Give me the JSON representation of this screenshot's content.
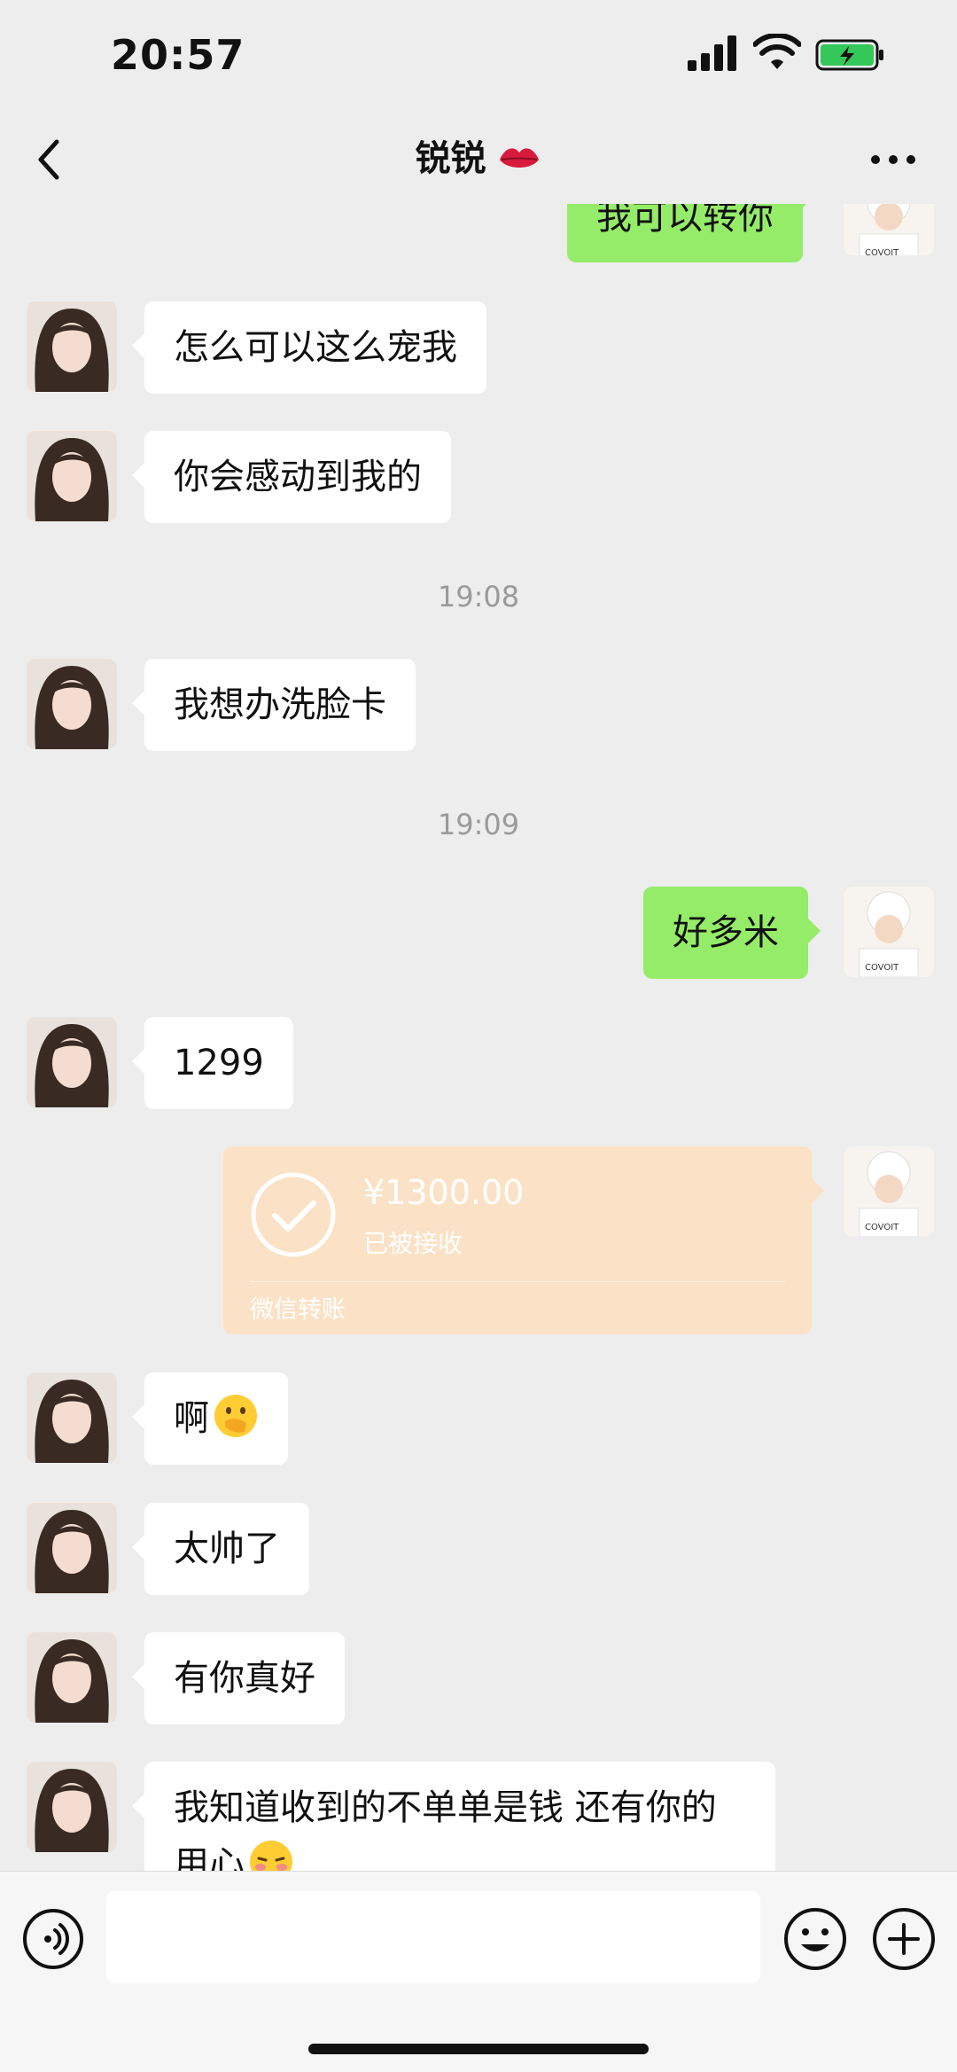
{
  "status_bar": {
    "time": "20:57"
  },
  "header": {
    "title": "锐锐",
    "title_icon": "kiss-lips-icon",
    "more_icon": "more-icon",
    "back_icon": "back-icon"
  },
  "messages": [
    {
      "side": "out",
      "text": "我可以转你"
    },
    {
      "side": "in",
      "text": "怎么可以这么宠我"
    },
    {
      "side": "in",
      "text": "你会感动到我的"
    },
    {
      "type": "time",
      "text": "19:08"
    },
    {
      "side": "in",
      "text": "我想办洗脸卡"
    },
    {
      "type": "time",
      "text": "19:09"
    },
    {
      "side": "out",
      "text": "好多米"
    },
    {
      "side": "in",
      "text": "1299"
    },
    {
      "side": "out",
      "type": "transfer",
      "amount": "¥1300.00",
      "status": "已被接收",
      "label": "微信转账"
    },
    {
      "side": "in",
      "text": "啊",
      "emoji": "hand-over-mouth-emoji"
    },
    {
      "side": "in",
      "text": "太帅了"
    },
    {
      "side": "in",
      "text": "有你真好"
    },
    {
      "side": "in",
      "text": "我知道收到的不单单是钱 还有你的用心",
      "emoji": "shy-face-emoji"
    }
  ],
  "input_bar": {
    "text_value": "",
    "voice_icon": "voice-icon",
    "emoji_icon": "emoji-icon",
    "plus_icon": "plus-icon"
  },
  "colors": {
    "background": "#ededed",
    "outgoing_bubble": "#95ec69",
    "incoming_bubble": "#ffffff",
    "transfer_card": "#fbe2c6"
  }
}
